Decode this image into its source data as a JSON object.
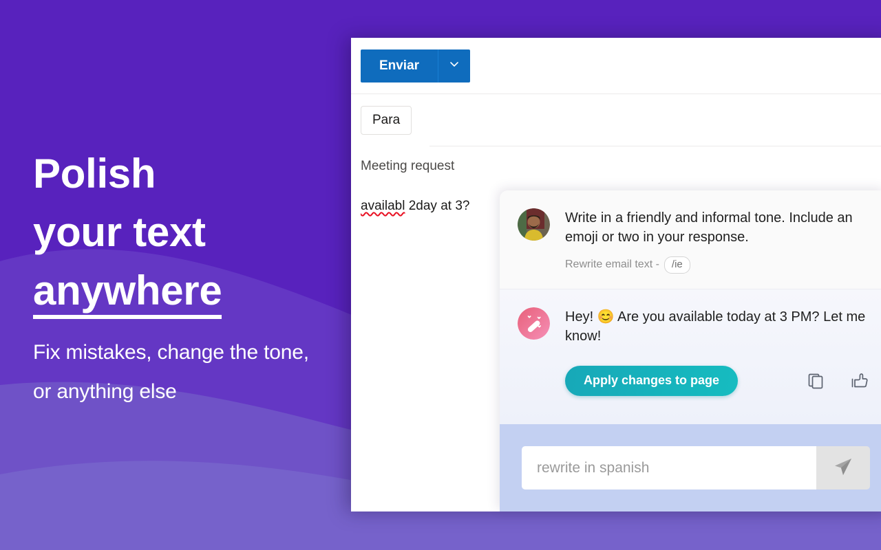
{
  "hero": {
    "headline_lines": [
      "Polish",
      "your text",
      "anywhere"
    ],
    "subcopy": "Fix mistakes, change the tone, or anything else",
    "bg_color": "#5822bd",
    "text_color": "#ffffff"
  },
  "email": {
    "send_button": "Enviar",
    "send_dropdown_icon": "chevron-down-icon",
    "to_field_label": "Para",
    "to_field_value": "",
    "subject": "Meeting request",
    "body_misspelled_word": "availabl",
    "body_rest": " 2day at 3?",
    "send_button_color": "#0f6cbd"
  },
  "assistant": {
    "user_message": {
      "avatar": "user-photo-avatar",
      "text": "Write in a friendly and informal tone. Include an emoji or two in your response.",
      "meta_label": "Rewrite email text -",
      "command_chip": "/ie"
    },
    "reply": {
      "avatar": "magic-wand-icon",
      "text": "Hey! 😊 Are you available today at 3 PM? Let me know!",
      "apply_button": "Apply changes to page",
      "apply_button_color": "#17a8b8",
      "copy_icon": "copy-icon",
      "thumbs_up_icon": "thumbs-up-icon"
    },
    "composer": {
      "placeholder": "rewrite in spanish",
      "value": "",
      "send_icon": "paper-plane-icon",
      "background_color": "#c3d0f2"
    }
  }
}
